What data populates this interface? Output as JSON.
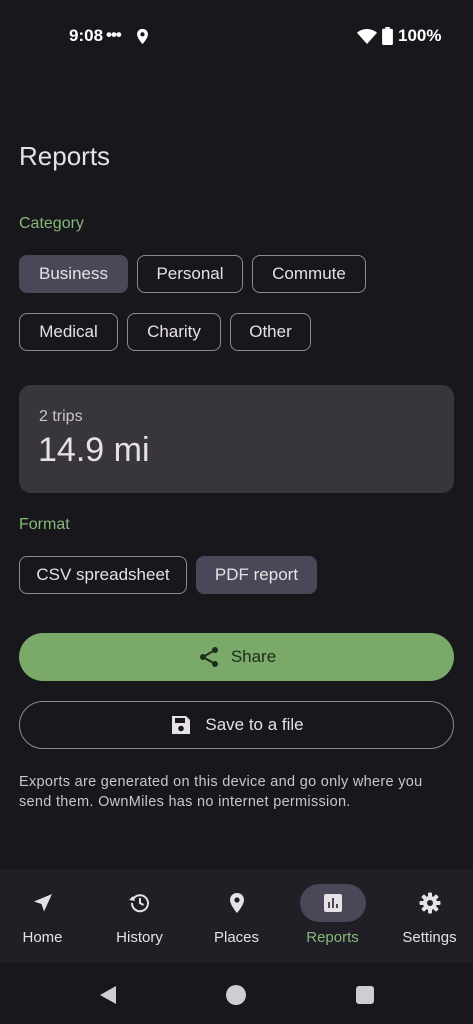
{
  "status_bar": {
    "time": "9:08",
    "dots": "•••",
    "battery": "100%"
  },
  "page": {
    "title": "Reports"
  },
  "category": {
    "label": "Category",
    "chips": [
      {
        "label": "Business",
        "selected": true
      },
      {
        "label": "Personal",
        "selected": false
      },
      {
        "label": "Commute",
        "selected": false
      },
      {
        "label": "Medical",
        "selected": false
      },
      {
        "label": "Charity",
        "selected": false
      },
      {
        "label": "Other",
        "selected": false
      }
    ]
  },
  "summary": {
    "trips": "2 trips",
    "distance": "14.9 mi"
  },
  "format": {
    "label": "Format",
    "chips": [
      {
        "label": "CSV spreadsheet",
        "selected": false
      },
      {
        "label": "PDF report",
        "selected": true
      }
    ]
  },
  "actions": {
    "share_label": "Share",
    "save_label": "Save to a file"
  },
  "footnote": "Exports are generated on this device and go only where you send them. OwnMiles has no internet permission.",
  "nav": {
    "items": [
      {
        "label": "Home",
        "icon": "navigation-arrow-icon"
      },
      {
        "label": "History",
        "icon": "history-icon"
      },
      {
        "label": "Places",
        "icon": "location-pin-icon"
      },
      {
        "label": "Reports",
        "icon": "bar-chart-icon",
        "active": true
      },
      {
        "label": "Settings",
        "icon": "gear-icon"
      }
    ]
  },
  "colors": {
    "accent": "#86b878",
    "share_button": "#7aa96a",
    "selected_chip": "#4a4758",
    "background": "#18171c"
  }
}
